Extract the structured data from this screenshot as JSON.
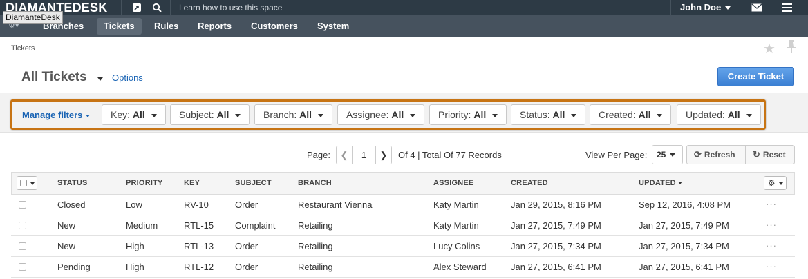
{
  "topbar": {
    "logo": "DIAMANTEDESK",
    "logo_tooltip": "DiamanteDesk",
    "learn": "Learn how to use this space",
    "user": "John Doe"
  },
  "nav": {
    "items": [
      "Branches",
      "Tickets",
      "Rules",
      "Reports",
      "Customers",
      "System"
    ],
    "active": "Tickets"
  },
  "breadcrumb": "Tickets",
  "page": {
    "title": "All Tickets",
    "options": "Options",
    "create_button": "Create Ticket"
  },
  "filters": {
    "manage": "Manage filters",
    "items": [
      {
        "name": "Key:",
        "value": "All"
      },
      {
        "name": "Subject:",
        "value": "All"
      },
      {
        "name": "Branch:",
        "value": "All"
      },
      {
        "name": "Assignee:",
        "value": "All"
      },
      {
        "name": "Priority:",
        "value": "All"
      },
      {
        "name": "Status:",
        "value": "All"
      },
      {
        "name": "Created:",
        "value": "All"
      },
      {
        "name": "Updated:",
        "value": "All"
      }
    ]
  },
  "pager": {
    "label": "Page:",
    "current": "1",
    "total": "Of 4 | Total Of 77 Records",
    "view_per_page_label": "View Per Page:",
    "per_page": "25",
    "refresh": "Refresh",
    "reset": "Reset"
  },
  "table": {
    "columns": [
      "STATUS",
      "PRIORITY",
      "KEY",
      "SUBJECT",
      "BRANCH",
      "ASSIGNEE",
      "CREATED",
      "UPDATED"
    ],
    "sorted_column": "UPDATED",
    "rows": [
      {
        "status": "Closed",
        "priority": "Low",
        "key": "RV-10",
        "subject": "Order",
        "branch": "Restaurant Vienna",
        "assignee": "Katy Martin",
        "created": "Jan 29, 2015, 8:16 PM",
        "updated": "Sep 12, 2016, 4:08 PM"
      },
      {
        "status": "New",
        "priority": "Medium",
        "key": "RTL-15",
        "subject": "Complaint",
        "branch": "Retailing",
        "assignee": "Katy Martin",
        "created": "Jan 27, 2015, 7:49 PM",
        "updated": "Jan 27, 2015, 7:49 PM"
      },
      {
        "status": "New",
        "priority": "High",
        "key": "RTL-13",
        "subject": "Order",
        "branch": "Retailing",
        "assignee": "Lucy Colins",
        "created": "Jan 27, 2015, 7:34 PM",
        "updated": "Jan 27, 2015, 7:34 PM"
      },
      {
        "status": "Pending",
        "priority": "High",
        "key": "RTL-12",
        "subject": "Order",
        "branch": "Retailing",
        "assignee": "Alex Steward",
        "created": "Jan 27, 2015, 6:41 PM",
        "updated": "Jan 27, 2015, 6:41 PM"
      }
    ],
    "row_menu": "···"
  },
  "colors": {
    "topbar": "#2d3a45",
    "navbar": "#46525e",
    "link": "#1a64b4",
    "primary_button": "#3b7fd3",
    "highlight_outline": "#c77414"
  }
}
